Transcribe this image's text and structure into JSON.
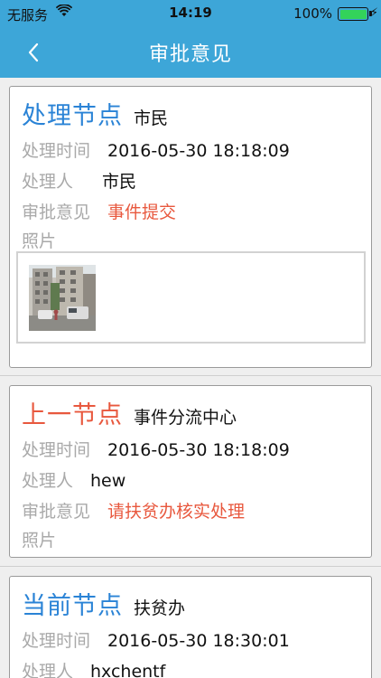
{
  "status": {
    "carrier": "无服务",
    "time": "14:19",
    "battery": "100%"
  },
  "nav": {
    "title": "审批意见",
    "back_icon": "chevron-left-icon"
  },
  "labels": {
    "time": "处理时间",
    "person": "处理人",
    "opinion": "审批意见",
    "photo": "照片"
  },
  "colors": {
    "header": "#3da6d8",
    "blue_title": "#2a83d6",
    "red_text": "#e8583e"
  },
  "cards": [
    {
      "title": "处理节点",
      "name": "市民",
      "time": "2016-05-30 18:18:09",
      "person": "市民",
      "opinion": "事件提交"
    },
    {
      "title": "上一节点",
      "name": "事件分流中心",
      "time": "2016-05-30 18:18:09",
      "person": "hew",
      "opinion": "请扶贫办核实处理"
    },
    {
      "title": "当前节点",
      "name": "扶贫办",
      "time": "2016-05-30 18:30:01",
      "person": "hxchentf"
    }
  ]
}
